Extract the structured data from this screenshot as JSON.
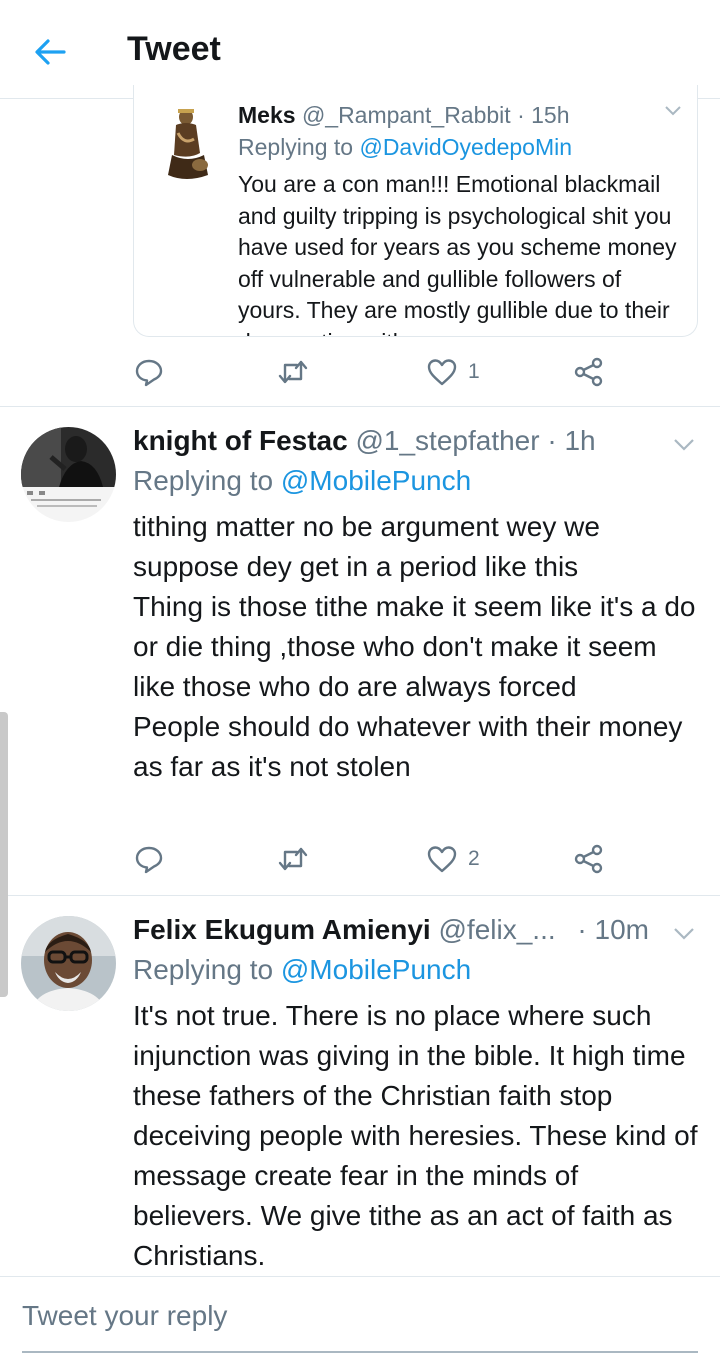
{
  "header": {
    "title": "Tweet"
  },
  "quoted": {
    "name": "Meks",
    "handle": "@_Rampant_Rabbit",
    "time": "· 15h",
    "replying_prefix": "Replying to",
    "replying_handle": "@DavidOyedepoMin",
    "text": "You are a con man!!! Emotional blackmail and guilty tripping is psychological shit you have used for years as you scheme money off vulnerable and gullible followers of yours. They are mostly gullible due to their desperation with",
    "likes": "1"
  },
  "tweets": [
    {
      "name": "knight of Festac",
      "handle": "@1_stepfather",
      "time": "· 1h",
      "replying_prefix": "Replying to",
      "replying_handle": "@MobilePunch",
      "text": "tithing matter no be argument wey we suppose dey get in a period like this\nThing is those tithe make it seem like it's a do or die thing ,those who don't make it seem like those who do are always forced\nPeople should do whatever with their money  as far as it's not stolen",
      "likes": "2"
    },
    {
      "name": "Felix Ekugum Amienyi",
      "handle": "@felix_...",
      "time": "· 10m",
      "replying_prefix": "Replying to",
      "replying_handle": "@MobilePunch",
      "text": "It's not true. There is no place where such injunction was giving in the bible. It high time these fathers of the Christian faith stop deceiving people with heresies. These kind of message create fear in the minds of believers. We give tithe as an act of faith as Christians."
    }
  ],
  "reply_bar": {
    "placeholder": "Tweet your reply"
  },
  "colors": {
    "accent": "#1da1f2",
    "link": "#1b95e0",
    "muted": "#657786",
    "border": "#e1e8ed"
  }
}
